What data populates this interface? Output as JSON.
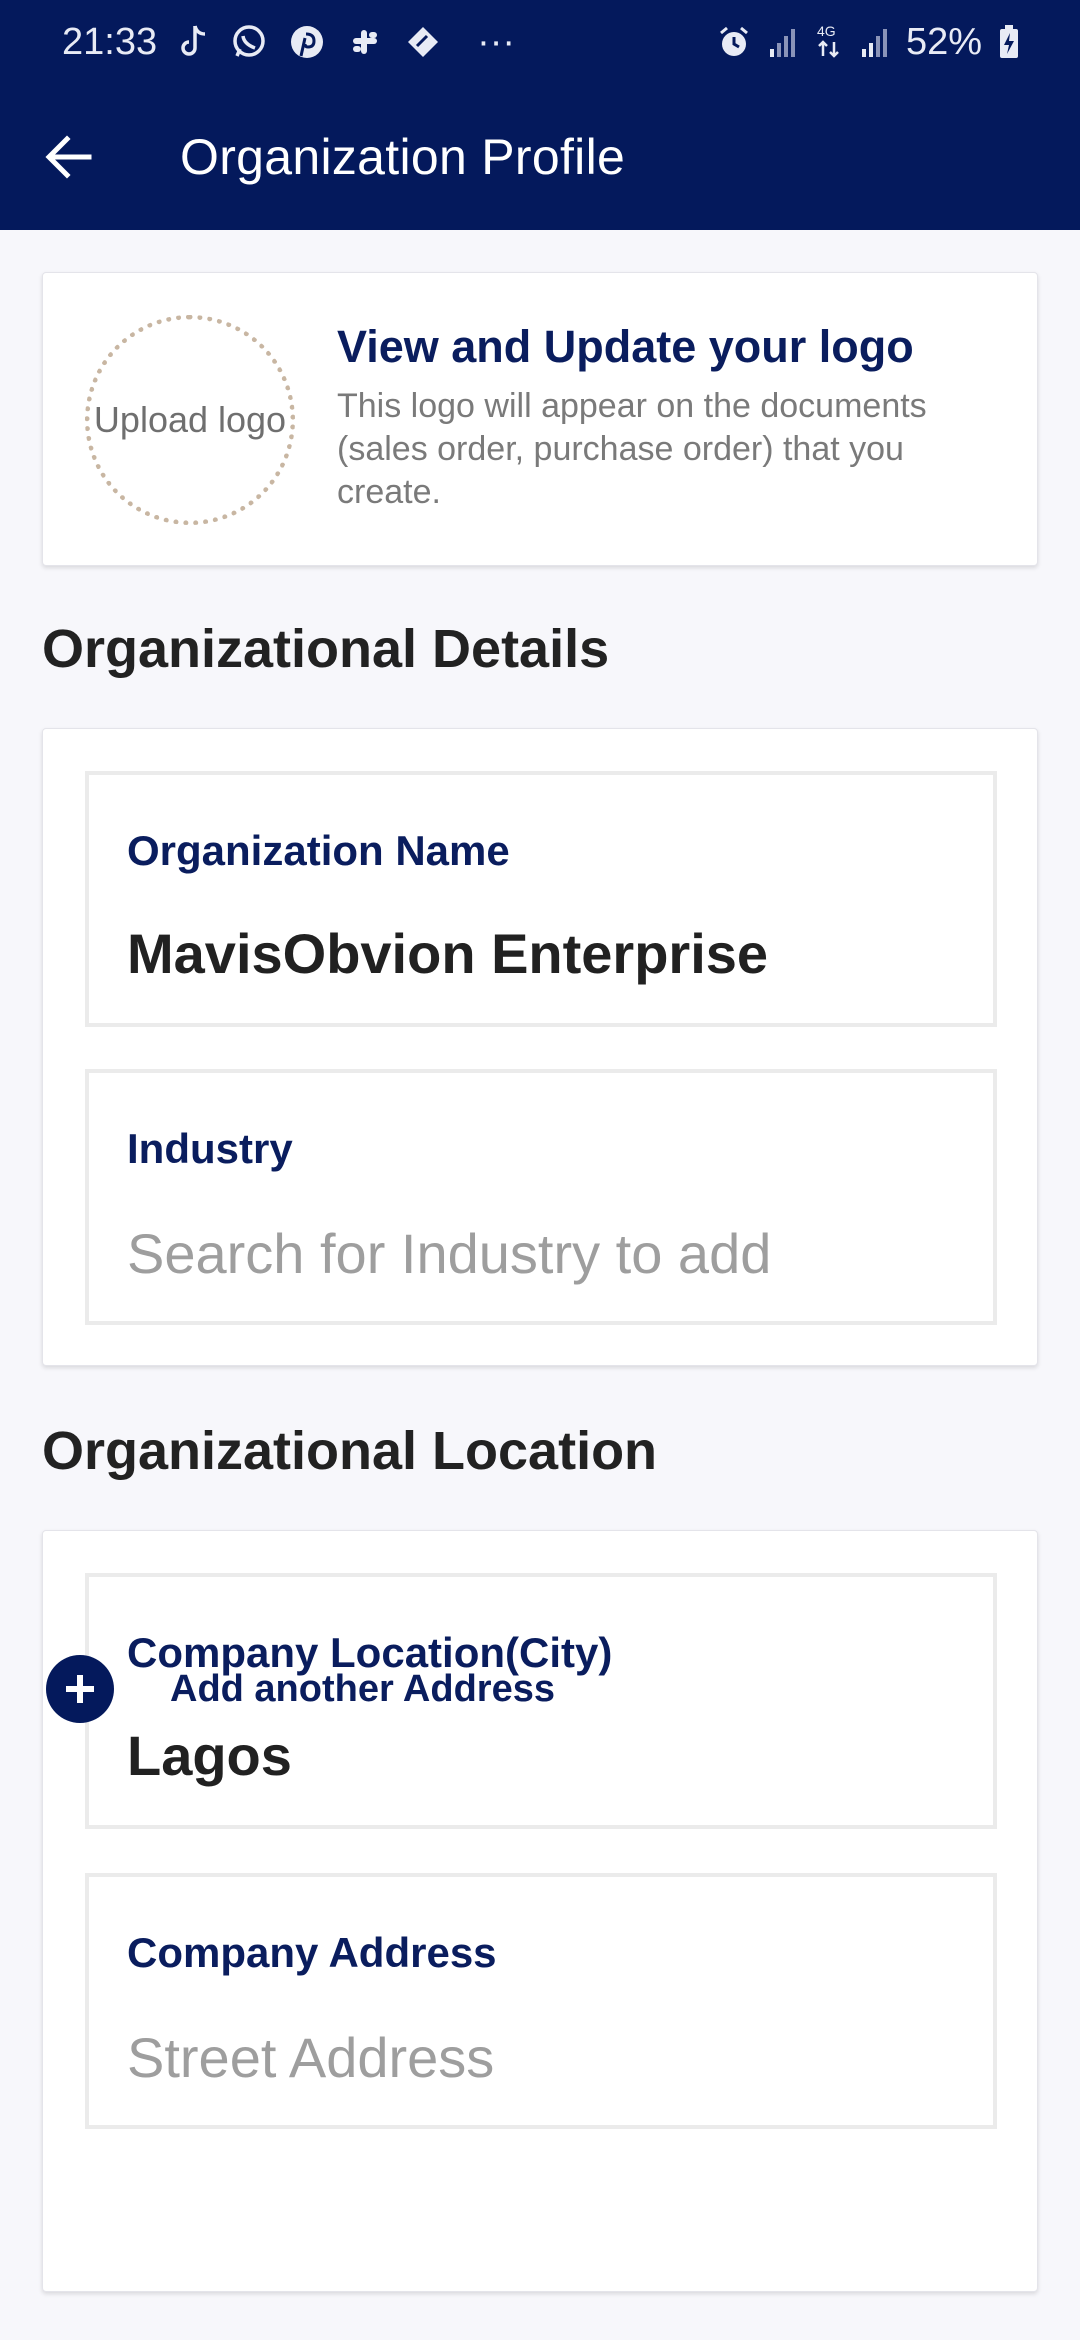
{
  "status_bar": {
    "time": "21:33",
    "notification_icons": [
      "tiktok-icon",
      "whatsapp-icon",
      "pinterest-icon",
      "slack-icon",
      "feather-icon"
    ],
    "more": "···",
    "battery": "52%",
    "network": "4G"
  },
  "app_bar": {
    "title": "Organization Profile",
    "back_icon": "arrow-left-icon",
    "background": "#04195c"
  },
  "logo_card": {
    "upload_label": "Upload logo",
    "title": "View and Update your logo",
    "description": "This logo will appear on the documents (sales order, purchase order) that you create."
  },
  "organizational_details": {
    "heading": "Organizational Details",
    "organization_name": {
      "label": "Organization Name",
      "value": "MavisObvion Enterprise"
    },
    "industry": {
      "label": "Industry",
      "placeholder": "Search for  Industry to add"
    }
  },
  "organizational_location": {
    "heading": "Organizational Location",
    "city": {
      "label": "Company Location(City)",
      "value": "Lagos"
    },
    "address": {
      "label": "Company Address",
      "placeholder": "Street Address"
    },
    "add_address_label": "Add another Address"
  },
  "colors": {
    "primary": "#04195c",
    "label": "#0a1d5e",
    "placeholder": "#9e9e9e"
  }
}
